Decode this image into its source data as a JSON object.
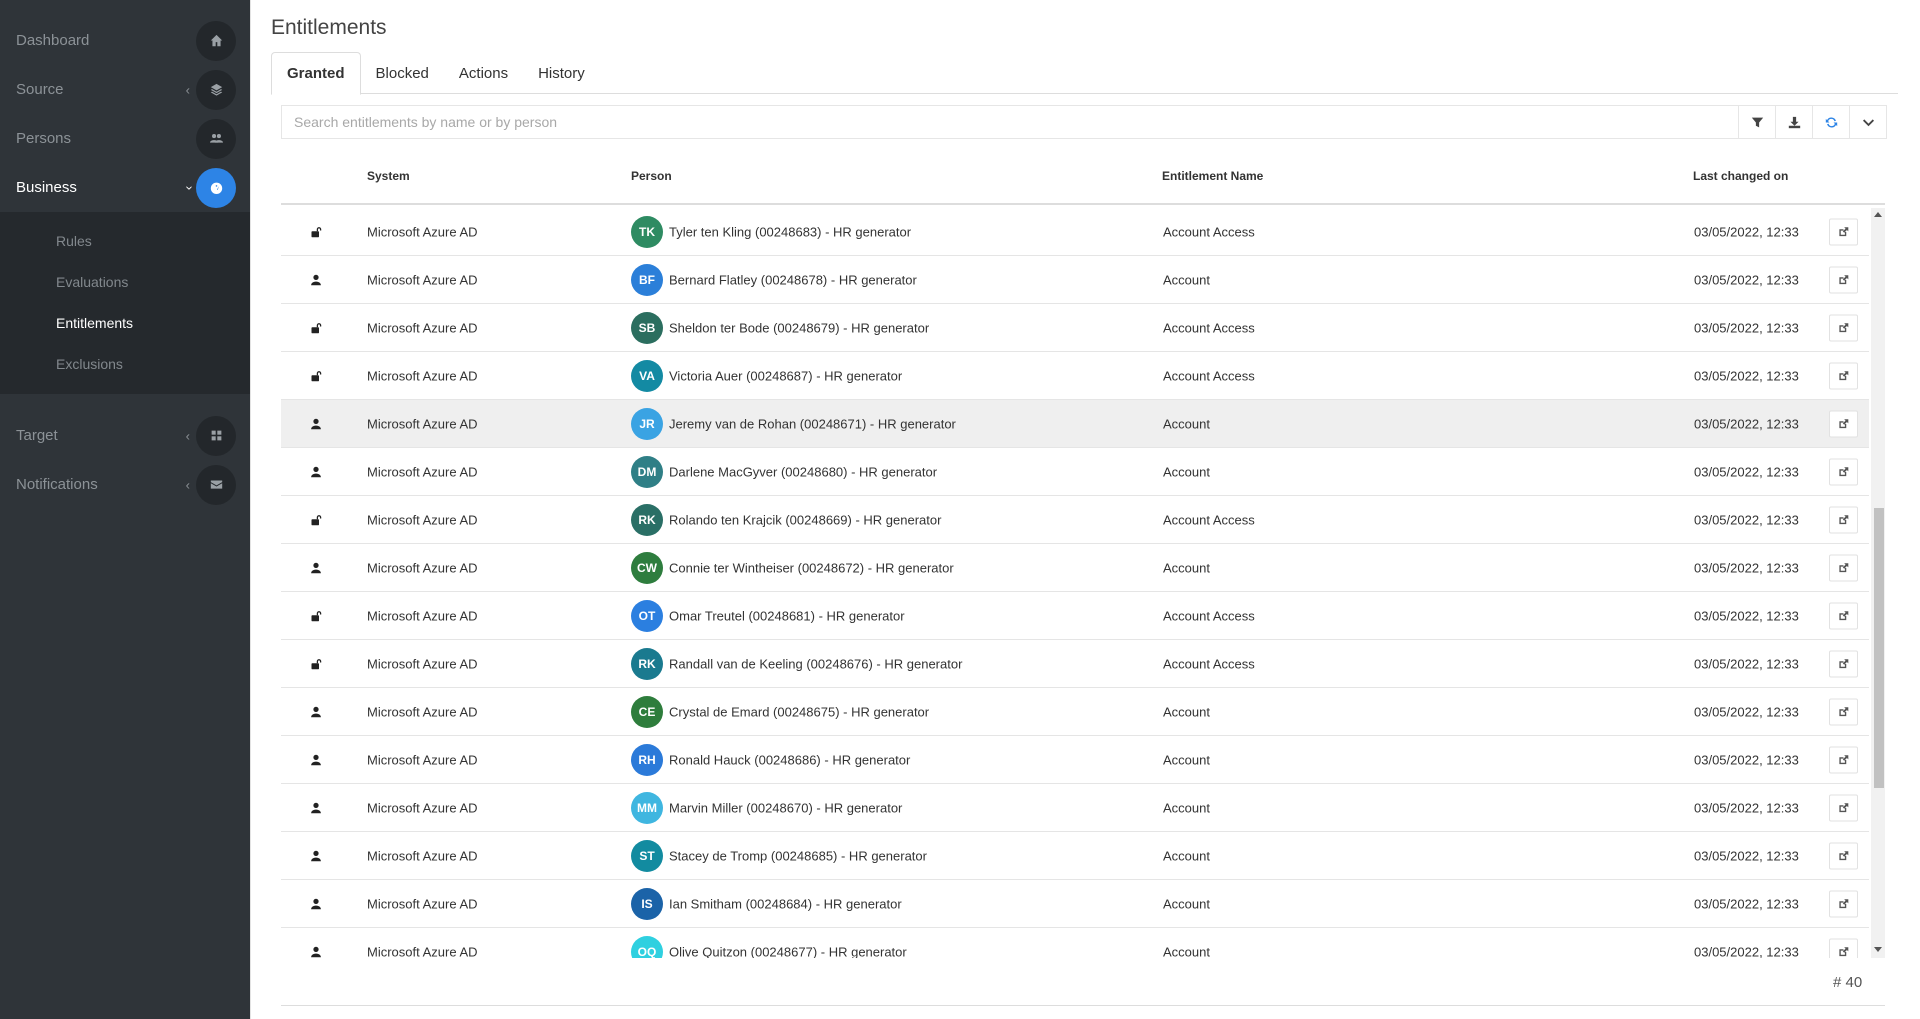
{
  "sidebar": {
    "items": [
      {
        "label": "Dashboard",
        "icon": "home-icon"
      },
      {
        "label": "Source",
        "icon": "layers-icon"
      },
      {
        "label": "Persons",
        "icon": "users-icon"
      },
      {
        "label": "Business",
        "icon": "dashboard-icon"
      },
      {
        "label": "Target",
        "icon": "grid-icon"
      },
      {
        "label": "Notifications",
        "icon": "envelope-icon"
      }
    ],
    "business_sub": [
      "Rules",
      "Evaluations",
      "Entitlements",
      "Exclusions"
    ]
  },
  "page": {
    "title": "Entitlements"
  },
  "tabs": [
    "Granted",
    "Blocked",
    "Actions",
    "History"
  ],
  "search": {
    "placeholder": "Search entitlements by name or by person"
  },
  "table": {
    "headers": {
      "system": "System",
      "person": "Person",
      "entitlement": "Entitlement Name",
      "changed": "Last changed on"
    },
    "rows": [
      {
        "type": "unlock-icon",
        "system": "Microsoft Azure AD",
        "initials": "TK",
        "color": "#2e8b62",
        "person": "Tyler ten Kling (00248683) - HR generator",
        "entitlement": "Account Access",
        "changed": "03/05/2022, 12:33"
      },
      {
        "type": "user-icon",
        "system": "Microsoft Azure AD",
        "initials": "BF",
        "color": "#2b7fd9",
        "person": "Bernard Flatley (00248678) - HR generator",
        "entitlement": "Account",
        "changed": "03/05/2022, 12:33"
      },
      {
        "type": "unlock-icon",
        "system": "Microsoft Azure AD",
        "initials": "SB",
        "color": "#2b6e5f",
        "person": "Sheldon ter Bode (00248679) - HR generator",
        "entitlement": "Account Access",
        "changed": "03/05/2022, 12:33"
      },
      {
        "type": "unlock-icon",
        "system": "Microsoft Azure AD",
        "initials": "VA",
        "color": "#138aa3",
        "person": "Victoria Auer (00248687) - HR generator",
        "entitlement": "Account Access",
        "changed": "03/05/2022, 12:33"
      },
      {
        "type": "user-icon",
        "system": "Microsoft Azure AD",
        "initials": "JR",
        "color": "#3aa3e3",
        "person": "Jeremy van de Rohan (00248671) - HR generator",
        "entitlement": "Account",
        "changed": "03/05/2022, 12:33"
      },
      {
        "type": "user-icon",
        "system": "Microsoft Azure AD",
        "initials": "DM",
        "color": "#2f7f86",
        "person": "Darlene MacGyver (00248680) - HR generator",
        "entitlement": "Account",
        "changed": "03/05/2022, 12:33"
      },
      {
        "type": "unlock-icon",
        "system": "Microsoft Azure AD",
        "initials": "RK",
        "color": "#2a6f66",
        "person": "Rolando ten Krajcik (00248669) - HR generator",
        "entitlement": "Account Access",
        "changed": "03/05/2022, 12:33"
      },
      {
        "type": "user-icon",
        "system": "Microsoft Azure AD",
        "initials": "CW",
        "color": "#2e7d3e",
        "person": "Connie ter Wintheiser (00248672) - HR generator",
        "entitlement": "Account",
        "changed": "03/05/2022, 12:33"
      },
      {
        "type": "unlock-icon",
        "system": "Microsoft Azure AD",
        "initials": "OT",
        "color": "#2b7fe0",
        "person": "Omar Treutel (00248681) - HR generator",
        "entitlement": "Account Access",
        "changed": "03/05/2022, 12:33"
      },
      {
        "type": "unlock-icon",
        "system": "Microsoft Azure AD",
        "initials": "RK",
        "color": "#1a7a8f",
        "person": "Randall van de Keeling (00248676) - HR generator",
        "entitlement": "Account Access",
        "changed": "03/05/2022, 12:33"
      },
      {
        "type": "user-icon",
        "system": "Microsoft Azure AD",
        "initials": "CE",
        "color": "#2e7d3c",
        "person": "Crystal de Emard (00248675) - HR generator",
        "entitlement": "Account",
        "changed": "03/05/2022, 12:33"
      },
      {
        "type": "user-icon",
        "system": "Microsoft Azure AD",
        "initials": "RH",
        "color": "#2b7ad9",
        "person": "Ronald Hauck (00248686) - HR generator",
        "entitlement": "Account",
        "changed": "03/05/2022, 12:33"
      },
      {
        "type": "user-icon",
        "system": "Microsoft Azure AD",
        "initials": "MM",
        "color": "#3fb6e0",
        "person": "Marvin Miller (00248670) - HR generator",
        "entitlement": "Account",
        "changed": "03/05/2022, 12:33"
      },
      {
        "type": "user-icon",
        "system": "Microsoft Azure AD",
        "initials": "ST",
        "color": "#128ba0",
        "person": "Stacey de Tromp (00248685) - HR generator",
        "entitlement": "Account",
        "changed": "03/05/2022, 12:33"
      },
      {
        "type": "user-icon",
        "system": "Microsoft Azure AD",
        "initials": "IS",
        "color": "#1b63a8",
        "person": "Ian Smitham (00248684) - HR generator",
        "entitlement": "Account",
        "changed": "03/05/2022, 12:33"
      },
      {
        "type": "user-icon",
        "system": "Microsoft Azure AD",
        "initials": "OQ",
        "color": "#2fd0e0",
        "person": "Olive Quitzon (00248677) - HR generator",
        "entitlement": "Account",
        "changed": "03/05/2022, 12:33"
      }
    ]
  },
  "footer": {
    "count": "# 40"
  }
}
